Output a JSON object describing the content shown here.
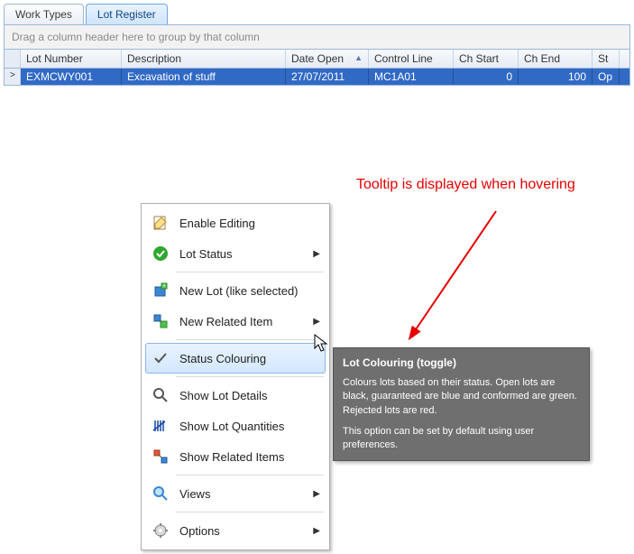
{
  "tabs": {
    "work_types": "Work Types",
    "lot_register": "Lot Register"
  },
  "group_bar": "Drag a column header here to group by that column",
  "columns": {
    "lot_number": "Lot Number",
    "description": "Description",
    "date_open": "Date Open",
    "control_line": "Control Line",
    "ch_start": "Ch Start",
    "ch_end": "Ch End",
    "status": "St"
  },
  "row": {
    "indicator": ">",
    "lot_number": "EXMCWY001",
    "description": "Excavation of stuff",
    "date_open": "27/07/2011",
    "control_line": "MC1A01",
    "ch_start": "0",
    "ch_end": "100",
    "status": "Op"
  },
  "annotation": "Tooltip is displayed when hovering",
  "menu": {
    "enable_editing": "Enable Editing",
    "lot_status": "Lot Status",
    "new_lot": "New Lot (like selected)",
    "new_related": "New Related Item",
    "status_colouring": "Status Colouring",
    "show_lot_details": "Show Lot Details",
    "show_lot_quantities": "Show Lot Quantities",
    "show_related_items": "Show Related Items",
    "views": "Views",
    "options": "Options"
  },
  "tooltip": {
    "title": "Lot Colouring (toggle)",
    "body": "Colours lots based on their status. Open lots are black, guaranteed are blue and conformed are green. Rejected lots are red.",
    "footer": "This option can be set by default using user preferences."
  }
}
